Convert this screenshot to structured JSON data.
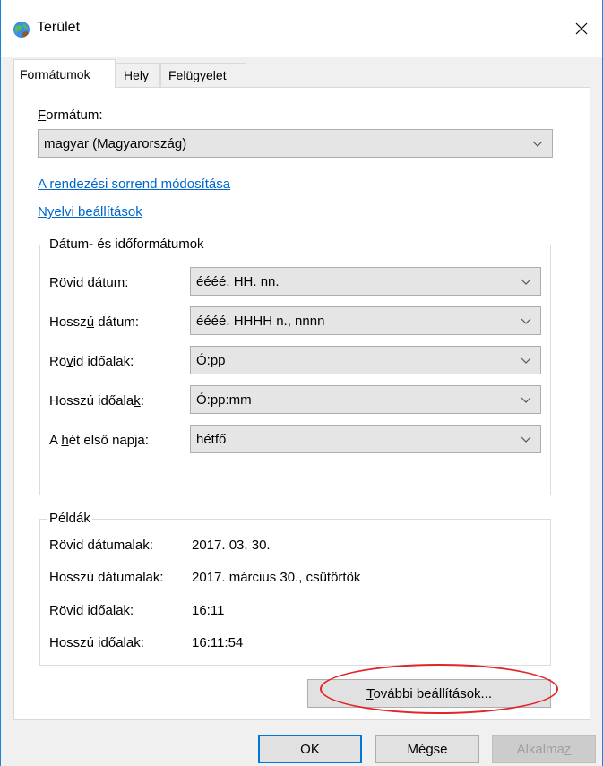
{
  "window": {
    "title": "Terület",
    "close_glyph": "✕"
  },
  "tabs": [
    {
      "label": "Formátumok",
      "active": true
    },
    {
      "label": "Hely",
      "active": false
    },
    {
      "label": "Felügyelet",
      "active": false
    }
  ],
  "format": {
    "label_accel": "F",
    "label_rest": "ormátum:",
    "value": "magyar (Magyarország)"
  },
  "links": {
    "sort_order": "A rendezési sorrend módosítása",
    "language_settings": "Nyelvi beállítások"
  },
  "datetime_group": {
    "title": "Dátum- és időformátumok",
    "rows": [
      {
        "label_pre": "",
        "label_accel": "R",
        "label_post": "övid dátum:",
        "value": "éééé. HH. nn."
      },
      {
        "label_pre": "Hossz",
        "label_accel": "ú",
        "label_post": " dátum:",
        "value": "éééé. HHHH n., nnnn"
      },
      {
        "label_pre": "Rö",
        "label_accel": "v",
        "label_post": "id időalak:",
        "value": "Ó:pp"
      },
      {
        "label_pre": "Hosszú időala",
        "label_accel": "k",
        "label_post": ":",
        "value": "Ó:pp:mm"
      },
      {
        "label_pre": "A ",
        "label_accel": "h",
        "label_post": "ét első napja:",
        "value": "hétfő"
      }
    ]
  },
  "examples": {
    "title": "Példák",
    "rows": [
      {
        "label": "Rövid dátumalak:",
        "value": "2017. 03. 30."
      },
      {
        "label": "Hosszú dátumalak:",
        "value": "2017. március 30., csütörtök"
      },
      {
        "label": "Rövid időalak:",
        "value": "16:11"
      },
      {
        "label": "Hosszú időalak:",
        "value": "16:11:54"
      }
    ]
  },
  "more_settings": {
    "accel": "T",
    "rest": "ovábbi beállítások..."
  },
  "footer": {
    "ok": "OK",
    "cancel": "Mégse",
    "apply_pre": "Alkalma",
    "apply_accel": "z"
  },
  "colors": {
    "link": "#0066cc",
    "highlight": "#e0262b",
    "accent": "#0078d7"
  }
}
